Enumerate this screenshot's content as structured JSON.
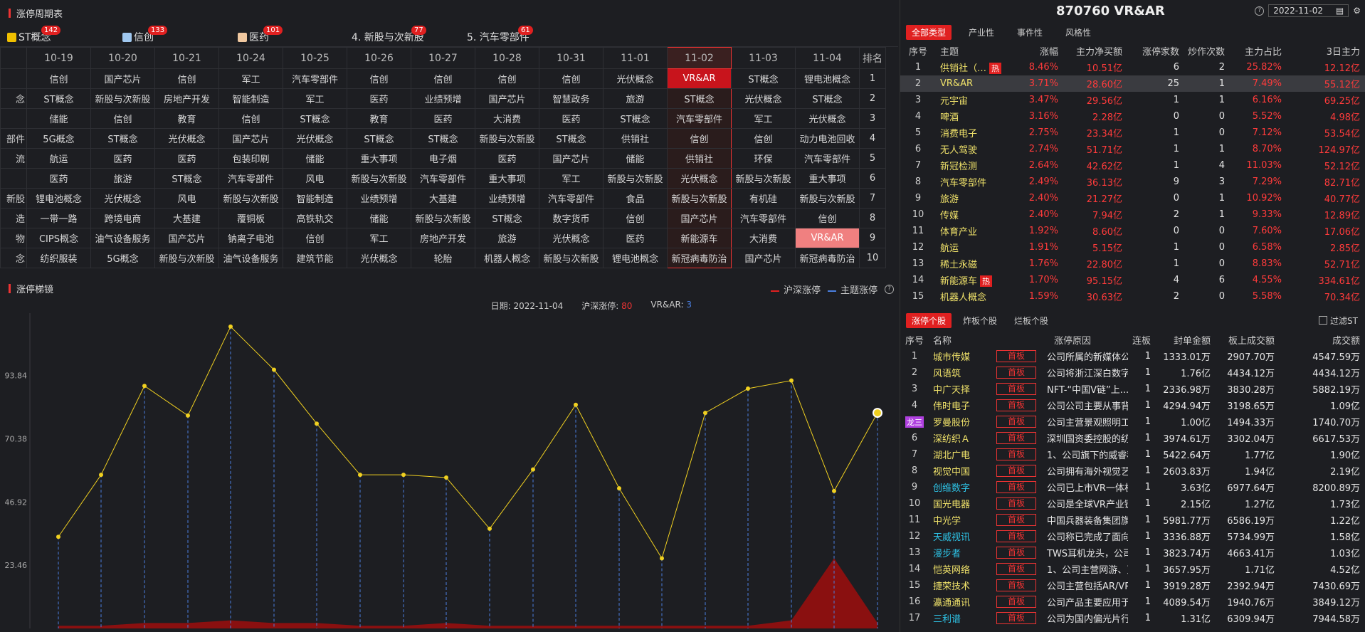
{
  "left_title": "涨停周期表",
  "theme_tabs": [
    {
      "label": "ST概念",
      "count": "142",
      "color": "#f0c000"
    },
    {
      "label": "信创",
      "count": "133",
      "color": "#a0c8f0"
    },
    {
      "label": "医药",
      "count": "101",
      "color": "#f0c8a0"
    },
    {
      "label": "4. 新股与次新股",
      "count": "77",
      "color": ""
    },
    {
      "label": "5. 汽车零部件",
      "count": "61",
      "color": ""
    }
  ],
  "grid": {
    "headers": [
      "10-19",
      "10-20",
      "10-21",
      "10-24",
      "10-25",
      "10-26",
      "10-27",
      "10-28",
      "10-31",
      "11-01",
      "11-02",
      "11-03",
      "11-04",
      "排名"
    ],
    "firstcol": [
      "",
      "念",
      "",
      "部件",
      "流",
      "",
      "新股",
      "造",
      "物",
      "念"
    ],
    "rows": [
      [
        "信创",
        "国产芯片",
        "信创",
        "军工",
        "汽车零部件",
        "信创",
        "信创",
        "信创",
        "信创",
        "光伏概念",
        "VR&AR",
        "ST概念",
        "锂电池概念",
        "1"
      ],
      [
        "ST概念",
        "新股与次新股",
        "房地产开发",
        "智能制造",
        "军工",
        "医药",
        "业绩预增",
        "国产芯片",
        "智慧政务",
        "旅游",
        "ST概念",
        "光伏概念",
        "ST概念",
        "2"
      ],
      [
        "储能",
        "信创",
        "教育",
        "信创",
        "ST概念",
        "教育",
        "医药",
        "大消费",
        "医药",
        "ST概念",
        "汽车零部件",
        "军工",
        "光伏概念",
        "3"
      ],
      [
        "5G概念",
        "ST概念",
        "光伏概念",
        "国产芯片",
        "光伏概念",
        "ST概念",
        "ST概念",
        "新股与次新股",
        "ST概念",
        "供销社",
        "信创",
        "信创",
        "动力电池回收",
        "4"
      ],
      [
        "航运",
        "医药",
        "医药",
        "包装印刷",
        "储能",
        "重大事项",
        "电子烟",
        "医药",
        "国产芯片",
        "储能",
        "供销社",
        "环保",
        "汽车零部件",
        "5"
      ],
      [
        "医药",
        "旅游",
        "ST概念",
        "汽车零部件",
        "风电",
        "新股与次新股",
        "汽车零部件",
        "重大事项",
        "军工",
        "新股与次新股",
        "光伏概念",
        "新股与次新股",
        "重大事项",
        "6"
      ],
      [
        "锂电池概念",
        "光伏概念",
        "风电",
        "新股与次新股",
        "智能制造",
        "业绩预增",
        "大基建",
        "业绩预增",
        "汽车零部件",
        "食品",
        "新股与次新股",
        "有机硅",
        "新股与次新股",
        "7"
      ],
      [
        "一带一路",
        "跨境电商",
        "大基建",
        "覆铜板",
        "高铁轨交",
        "储能",
        "新股与次新股",
        "ST概念",
        "数字货币",
        "信创",
        "国产芯片",
        "汽车零部件",
        "信创",
        "8"
      ],
      [
        "CIPS概念",
        "油气设备服务",
        "国产芯片",
        "钠离子电池",
        "信创",
        "军工",
        "房地产开发",
        "旅游",
        "光伏概念",
        "医药",
        "新能源车",
        "大消费",
        "VR&AR",
        "9"
      ],
      [
        "纺织服装",
        "5G概念",
        "新股与次新股",
        "油气设备服务",
        "建筑节能",
        "光伏概念",
        "轮胎",
        "机器人概念",
        "新股与次新股",
        "锂电池概念",
        "新冠病毒防治",
        "国产芯片",
        "新冠病毒防治",
        "10"
      ]
    ]
  },
  "chart_section": {
    "title": "涨停梯镜",
    "legend_a": "沪深涨停",
    "legend_b": "主题涨停",
    "legend_a_color": "#e02020",
    "legend_b_color": "#4a7fe0",
    "date_label": "日期:",
    "date_value": "2022-11-04",
    "hs_label": "沪深涨停:",
    "hs_value": "80",
    "theme_label": "VR&AR:",
    "theme_value": "3"
  },
  "chart_data": {
    "type": "line",
    "ylim": [
      0,
      117
    ],
    "yticks": [
      "23.46",
      "46.92",
      "70.38",
      "93.84"
    ],
    "series": [
      {
        "values": [
          34,
          57,
          90,
          79,
          112,
          96,
          76,
          57,
          57,
          56,
          37,
          59,
          83,
          52,
          26,
          80,
          89,
          92,
          51,
          80
        ]
      },
      {
        "values": [
          1,
          1,
          2,
          2,
          3,
          2,
          2,
          1,
          1,
          2,
          1,
          1,
          1,
          1,
          1,
          1,
          1,
          3,
          26,
          2
        ]
      }
    ],
    "colors": {
      "line": "#f0d020",
      "area": "#8a1010",
      "dash": "#4a7fe0"
    }
  },
  "right": {
    "title": "870760 VR&AR",
    "date": "2022-11-02",
    "tabs": [
      "全部类型",
      "产业性",
      "事件性",
      "风格性"
    ],
    "headers": [
      "序号",
      "主题",
      "涨幅",
      "主力净买额",
      "涨停家数",
      "炒作次数",
      "主力占比",
      "3日主力"
    ],
    "rows": [
      [
        "1",
        "供销社（…",
        "热",
        "8.46%",
        "10.51亿",
        "6",
        "2",
        "25.82%",
        "12.12亿"
      ],
      [
        "2",
        "VR&AR",
        "",
        "3.71%",
        "28.60亿",
        "25",
        "1",
        "7.49%",
        "55.12亿"
      ],
      [
        "3",
        "元宇宙",
        "",
        "3.47%",
        "29.56亿",
        "1",
        "1",
        "6.16%",
        "69.25亿"
      ],
      [
        "4",
        "啤酒",
        "",
        "3.16%",
        "2.28亿",
        "0",
        "0",
        "5.52%",
        "4.98亿"
      ],
      [
        "5",
        "消费电子",
        "",
        "2.75%",
        "23.34亿",
        "1",
        "0",
        "7.12%",
        "53.54亿"
      ],
      [
        "6",
        "无人驾驶",
        "",
        "2.74%",
        "51.71亿",
        "1",
        "1",
        "8.70%",
        "124.97亿"
      ],
      [
        "7",
        "新冠检测",
        "",
        "2.64%",
        "42.62亿",
        "1",
        "4",
        "11.03%",
        "52.12亿"
      ],
      [
        "8",
        "汽车零部件",
        "",
        "2.49%",
        "36.13亿",
        "9",
        "3",
        "7.29%",
        "82.71亿"
      ],
      [
        "9",
        "旅游",
        "",
        "2.40%",
        "21.27亿",
        "0",
        "1",
        "10.92%",
        "40.77亿"
      ],
      [
        "10",
        "传媒",
        "",
        "2.40%",
        "7.94亿",
        "2",
        "1",
        "9.33%",
        "12.89亿"
      ],
      [
        "11",
        "体育产业",
        "",
        "1.92%",
        "8.60亿",
        "0",
        "0",
        "7.60%",
        "17.06亿"
      ],
      [
        "12",
        "航运",
        "",
        "1.91%",
        "5.15亿",
        "1",
        "0",
        "6.58%",
        "2.85亿"
      ],
      [
        "13",
        "稀土永磁",
        "",
        "1.76%",
        "22.80亿",
        "1",
        "0",
        "8.83%",
        "52.71亿"
      ],
      [
        "14",
        "新能源车",
        "热",
        "1.70%",
        "95.15亿",
        "4",
        "6",
        "4.55%",
        "334.61亿"
      ],
      [
        "15",
        "机器人概念",
        "",
        "1.59%",
        "30.63亿",
        "2",
        "0",
        "5.58%",
        "70.34亿"
      ]
    ],
    "tabs2": [
      "涨停个股",
      "炸板个股",
      "烂板个股"
    ],
    "filter_label": "过滤ST",
    "headers2": [
      "序号",
      "名称",
      "涨停原因",
      "连板",
      "封单金额",
      "板上成交额",
      "成交额"
    ],
    "rows2": [
      [
        "1",
        "城市传媒",
        "",
        "首板",
        "公司所属的新媒体公...",
        "1",
        "1333.01万",
        "2907.70万",
        "4547.59万",
        "yel"
      ],
      [
        "2",
        "风语筑",
        "",
        "首板",
        "公司将浙江深白数字...",
        "1",
        "1.76亿",
        "4434.12万",
        "4434.12万",
        "yel"
      ],
      [
        "3",
        "中广天择",
        "",
        "首板",
        "NFT-“中国V链”上...",
        "1",
        "2336.98万",
        "3830.28万",
        "5882.19万",
        "yel"
      ],
      [
        "4",
        "伟时电子",
        "",
        "首板",
        "公司公司主要从事背...",
        "1",
        "4294.94万",
        "3198.65万",
        "1.09亿",
        "yel"
      ],
      [
        "5",
        "罗曼股份",
        "龙三",
        "首板",
        "公司主营景观照明工...",
        "1",
        "1.00亿",
        "1494.33万",
        "1740.70万",
        "yel"
      ],
      [
        "6",
        "深纺织Ａ",
        "",
        "首板",
        "深圳国资委控股的纺...",
        "1",
        "3974.61万",
        "3302.04万",
        "6617.53万",
        "yel"
      ],
      [
        "7",
        "湖北广电",
        "",
        "首板",
        "1、公司旗下的威睿科...",
        "1",
        "5422.64万",
        "1.77亿",
        "1.90亿",
        "yel"
      ],
      [
        "8",
        "视觉中国",
        "",
        "首板",
        "公司拥有海外视觉艺...",
        "1",
        "2603.83万",
        "1.94亿",
        "2.19亿",
        "yel"
      ],
      [
        "9",
        "创维数字",
        "",
        "首板",
        "公司已上市VR一体机...",
        "1",
        "3.63亿",
        "6977.64万",
        "8200.89万",
        "cyan"
      ],
      [
        "10",
        "国光电器",
        "",
        "首板",
        "公司是全球VR产业链...",
        "1",
        "2.15亿",
        "1.27亿",
        "1.73亿",
        "yel"
      ],
      [
        "11",
        "中光学",
        "",
        "首板",
        "中国兵器装备集团旗...",
        "1",
        "5981.77万",
        "6586.19万",
        "1.22亿",
        "yel"
      ],
      [
        "12",
        "天威视讯",
        "",
        "首板",
        "公司称已完成了面向...",
        "1",
        "3336.88万",
        "5734.99万",
        "1.58亿",
        "cyan"
      ],
      [
        "13",
        "漫步者",
        "",
        "首板",
        "TWS耳机龙头，公司...",
        "1",
        "3823.74万",
        "4663.41万",
        "1.03亿",
        "cyan"
      ],
      [
        "14",
        "恺英网络",
        "",
        "首板",
        "1、公司主营网游、页...",
        "1",
        "3657.95万",
        "1.71亿",
        "4.52亿",
        "yel"
      ],
      [
        "15",
        "捷荣技术",
        "",
        "首板",
        "公司主营包括AR/VR...",
        "1",
        "3919.28万",
        "2392.94万",
        "7430.69万",
        "yel"
      ],
      [
        "16",
        "瀛通通讯",
        "",
        "首板",
        "公司产品主要应用于...",
        "1",
        "4089.54万",
        "1940.76万",
        "3849.12万",
        "yel"
      ],
      [
        "17",
        "三利谱",
        "",
        "首板",
        "公司为国内偏光片行...",
        "1",
        "1.31亿",
        "6309.94万",
        "7944.58万",
        "cyan"
      ]
    ]
  }
}
